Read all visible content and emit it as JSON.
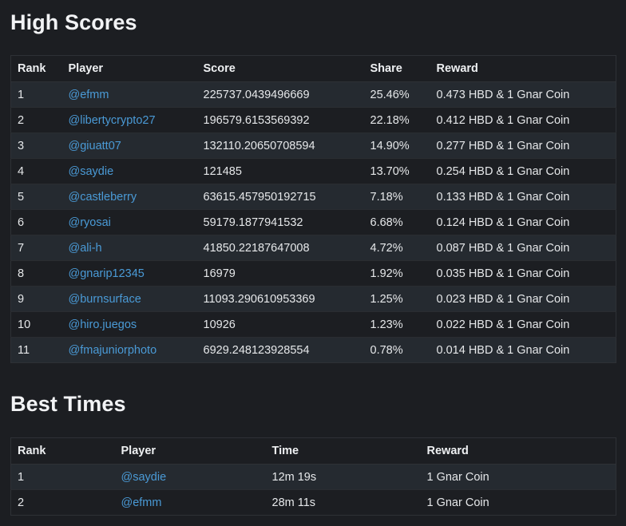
{
  "high_scores": {
    "title": "High Scores",
    "headers": {
      "rank": "Rank",
      "player": "Player",
      "score": "Score",
      "share": "Share",
      "reward": "Reward"
    },
    "rows": [
      {
        "rank": "1",
        "player": "@efmm",
        "score": "225737.0439496669",
        "share": "25.46%",
        "reward": "0.473 HBD & 1 Gnar Coin"
      },
      {
        "rank": "2",
        "player": "@libertycrypto27",
        "score": "196579.6153569392",
        "share": "22.18%",
        "reward": "0.412 HBD & 1 Gnar Coin"
      },
      {
        "rank": "3",
        "player": "@giuatt07",
        "score": "132110.20650708594",
        "share": "14.90%",
        "reward": "0.277 HBD & 1 Gnar Coin"
      },
      {
        "rank": "4",
        "player": "@saydie",
        "score": "121485",
        "share": "13.70%",
        "reward": "0.254 HBD & 1 Gnar Coin"
      },
      {
        "rank": "5",
        "player": "@castleberry",
        "score": "63615.457950192715",
        "share": "7.18%",
        "reward": "0.133 HBD & 1 Gnar Coin"
      },
      {
        "rank": "6",
        "player": "@ryosai",
        "score": "59179.1877941532",
        "share": "6.68%",
        "reward": "0.124 HBD & 1 Gnar Coin"
      },
      {
        "rank": "7",
        "player": "@ali-h",
        "score": "41850.22187647008",
        "share": "4.72%",
        "reward": "0.087 HBD & 1 Gnar Coin"
      },
      {
        "rank": "8",
        "player": "@gnarip12345",
        "score": "16979",
        "share": "1.92%",
        "reward": "0.035 HBD & 1 Gnar Coin"
      },
      {
        "rank": "9",
        "player": "@burnsurface",
        "score": "11093.290610953369",
        "share": "1.25%",
        "reward": "0.023 HBD & 1 Gnar Coin"
      },
      {
        "rank": "10",
        "player": "@hiro.juegos",
        "score": "10926",
        "share": "1.23%",
        "reward": "0.022 HBD & 1 Gnar Coin"
      },
      {
        "rank": "11",
        "player": "@fmajuniorphoto",
        "score": "6929.248123928554",
        "share": "0.78%",
        "reward": "0.014 HBD & 1 Gnar Coin"
      }
    ]
  },
  "best_times": {
    "title": "Best Times",
    "headers": {
      "rank": "Rank",
      "player": "Player",
      "time": "Time",
      "reward": "Reward"
    },
    "rows": [
      {
        "rank": "1",
        "player": "@saydie",
        "time": "12m 19s",
        "reward": "1 Gnar Coin"
      },
      {
        "rank": "2",
        "player": "@efmm",
        "time": "28m 11s",
        "reward": "1 Gnar Coin"
      }
    ]
  },
  "colors": {
    "background": "#1c1e22",
    "row_alt": "#252a30",
    "link": "#4a9ad6",
    "text": "#e6e8ea"
  }
}
